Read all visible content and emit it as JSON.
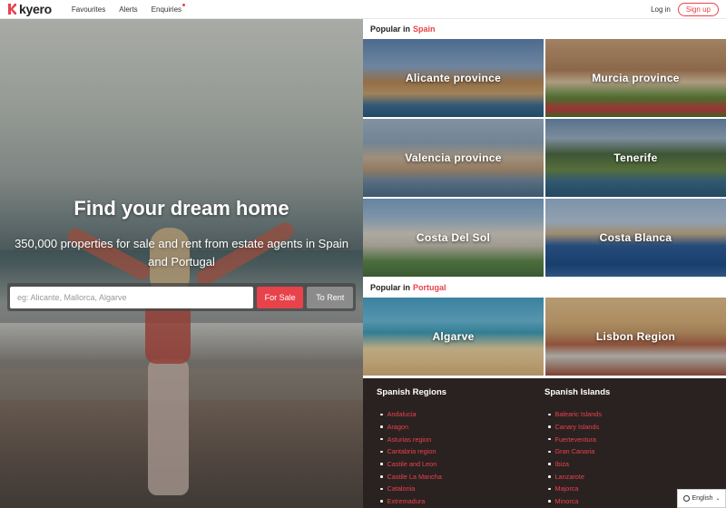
{
  "nav": {
    "logo_text": "kyero",
    "favourites": "Favourites",
    "alerts": "Alerts",
    "enquiries": "Enquiries",
    "login": "Log in",
    "signup": "Sign up"
  },
  "hero": {
    "title": "Find your dream home",
    "subtitle": "350,000 properties for sale and rent from estate agents in Spain and Portugal",
    "search_placeholder": "eg: Alicante, Mallorca, Algarve",
    "for_sale": "For Sale",
    "to_rent": "To Rent"
  },
  "spain": {
    "heading": "Popular in",
    "country": "Spain",
    "tiles": [
      {
        "label": "Alicante province"
      },
      {
        "label": "Murcia province"
      },
      {
        "label": "Valencia province"
      },
      {
        "label": "Tenerife"
      },
      {
        "label": "Costa Del Sol"
      },
      {
        "label": "Costa Blanca"
      }
    ]
  },
  "portugal": {
    "heading": "Popular in",
    "country": "Portugal",
    "tiles": [
      {
        "label": "Algarve"
      },
      {
        "label": "Lisbon Region"
      }
    ]
  },
  "regions": {
    "title": "Spanish Regions",
    "items": [
      "Andalucia",
      "Aragon",
      "Asturias region",
      "Cantabria region",
      "Castile and Leon",
      "Castile La Mancha",
      "Catalonia",
      "Extremadura"
    ]
  },
  "islands": {
    "title": "Spanish Islands",
    "items": [
      "Balearic Islands",
      "Canary Islands",
      "Fuerteventura",
      "Gran Canaria",
      "Ibiza",
      "Lanzarote",
      "Majorca",
      "Minorca"
    ]
  },
  "language": "English",
  "colors": {
    "accent": "#e8424b",
    "footer_bg": "#2a2221"
  }
}
